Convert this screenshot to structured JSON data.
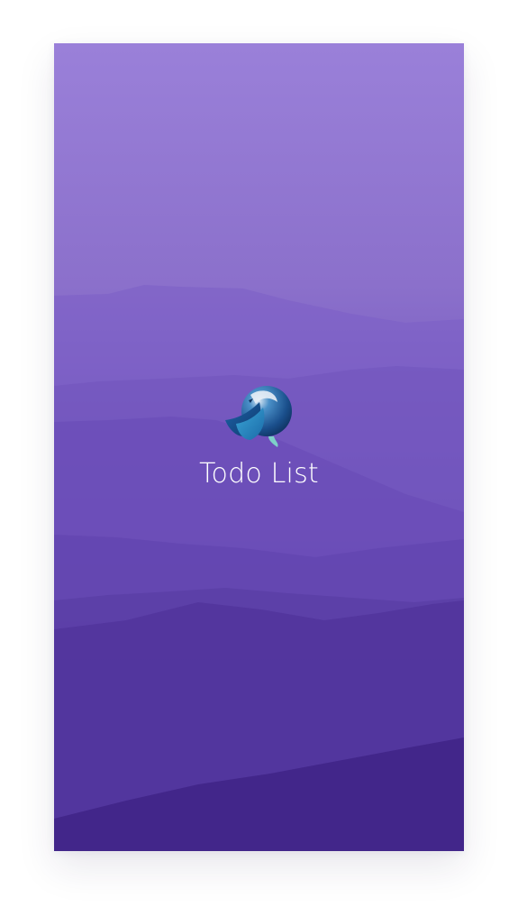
{
  "app": {
    "title": "Todo List",
    "logo_icon": "bird-globe-icon"
  },
  "colors": {
    "background_top": "#9a80d9",
    "background_bottom": "#3f2385",
    "title_text": "#ffffff"
  }
}
